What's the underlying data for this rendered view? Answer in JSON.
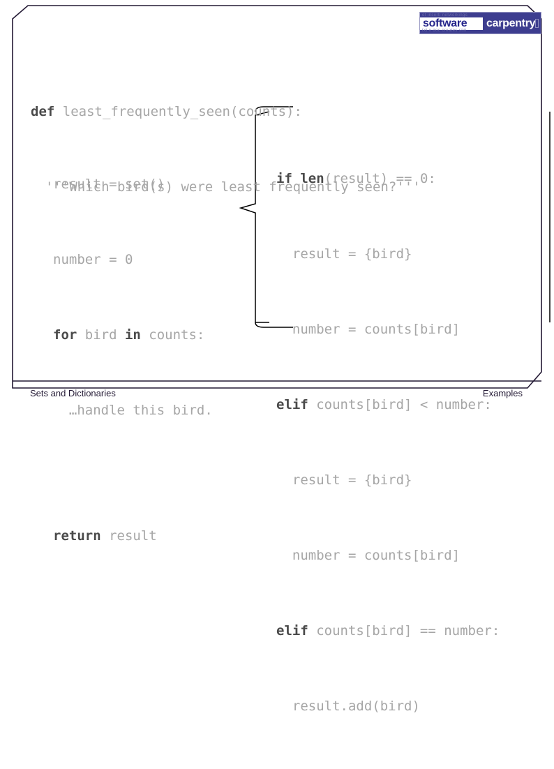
{
  "slide": {
    "border_color": "#241a35",
    "code_color": "#a6a6a6",
    "keyword_color": "#4a4a4a"
  },
  "logo": {
    "name": "software-carpentry-logo",
    "word1": "software",
    "word2": "carpentry",
    "ghost_top": "of   inserti  networkings",
    "ghost_bottom": "txt # doc  creates  still",
    "bg_color": "#3d3d8f",
    "word1_color": "#26268c",
    "word2_color": "#ffffff"
  },
  "code": {
    "header": [
      {
        "keyword": "def",
        "rest": " least_frequently_seen(counts):"
      }
    ],
    "docstring": "'''Which bird(s) were least frequently seen?'''",
    "left_block": [
      {
        "keyword": "",
        "rest": "result = set()"
      },
      {
        "keyword": "",
        "rest": "number = 0"
      },
      {
        "keyword": "for",
        "rest": " bird ",
        "keyword2": "in",
        "rest2": " counts:"
      },
      {
        "keyword": "",
        "rest": "  …handle this bird."
      },
      {
        "keyword": "",
        "rest": ""
      },
      {
        "keyword": "return",
        "rest": " result"
      }
    ],
    "right_block": [
      "if len(result) == 0:",
      "  result = {bird}",
      "  number = counts[bird]",
      "elif counts[bird] < number:",
      "  result = {bird}",
      "  number = counts[bird]",
      "elif counts[bird] == number:",
      "  result.add(bird)"
    ]
  },
  "footer": {
    "left": "Sets and Dictionaries",
    "right": "Examples"
  }
}
